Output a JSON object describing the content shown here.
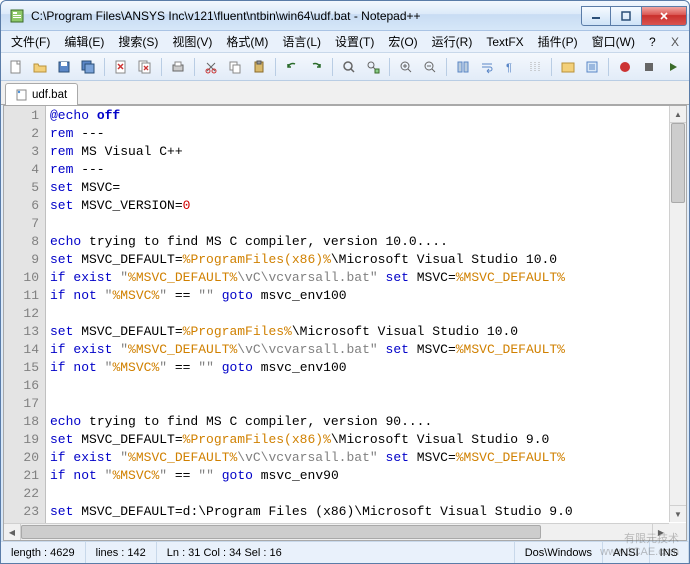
{
  "titlebar": {
    "text": "C:\\Program Files\\ANSYS Inc\\v121\\fluent\\ntbin\\win64\\udf.bat - Notepad++"
  },
  "menus": [
    {
      "label": "文件(F)"
    },
    {
      "label": "编辑(E)"
    },
    {
      "label": "搜索(S)"
    },
    {
      "label": "视图(V)"
    },
    {
      "label": "格式(M)"
    },
    {
      "label": "语言(L)"
    },
    {
      "label": "设置(T)"
    },
    {
      "label": "宏(O)"
    },
    {
      "label": "运行(R)"
    },
    {
      "label": "TextFX"
    },
    {
      "label": "插件(P)"
    },
    {
      "label": "窗口(W)"
    },
    {
      "label": "?"
    }
  ],
  "menu_close": "X",
  "tab": {
    "label": "udf.bat"
  },
  "code_lines": [
    {
      "n": 1,
      "tokens": [
        [
          "cmd",
          "@echo"
        ],
        [
          "",
          ""
        ],
        [
          "kw",
          " off"
        ]
      ]
    },
    {
      "n": 2,
      "tokens": [
        [
          "cmd",
          "rem"
        ],
        [
          "",
          " ---"
        ]
      ]
    },
    {
      "n": 3,
      "tokens": [
        [
          "cmd",
          "rem"
        ],
        [
          "",
          " MS Visual C++"
        ]
      ]
    },
    {
      "n": 4,
      "tokens": [
        [
          "cmd",
          "rem"
        ],
        [
          "",
          " ---"
        ]
      ]
    },
    {
      "n": 5,
      "tokens": [
        [
          "cmd",
          "set"
        ],
        [
          "",
          " MSVC"
        ],
        [
          "op",
          "="
        ]
      ]
    },
    {
      "n": 6,
      "tokens": [
        [
          "cmd",
          "set"
        ],
        [
          "",
          " MSVC_VERSION"
        ],
        [
          "op",
          "="
        ],
        [
          "num",
          "0"
        ]
      ]
    },
    {
      "n": 7,
      "tokens": [
        [
          "",
          ""
        ]
      ]
    },
    {
      "n": 8,
      "tokens": [
        [
          "cmd",
          "echo"
        ],
        [
          "",
          " trying to find MS C compiler, version 10.0...."
        ]
      ]
    },
    {
      "n": 9,
      "tokens": [
        [
          "cmd",
          "set"
        ],
        [
          "",
          " MSVC_DEFAULT"
        ],
        [
          "op",
          "="
        ],
        [
          "var",
          "%ProgramFiles(x86)%"
        ],
        [
          "",
          "\\Microsoft Visual Studio 10.0"
        ]
      ]
    },
    {
      "n": 10,
      "tokens": [
        [
          "cmd",
          "if exist"
        ],
        [
          "",
          " "
        ],
        [
          "str",
          "\""
        ],
        [
          "var",
          "%MSVC_DEFAULT%"
        ],
        [
          "str",
          "\\vC\\vcvarsall.bat\""
        ],
        [
          "",
          " "
        ],
        [
          "cmd",
          "set"
        ],
        [
          "",
          " MSVC"
        ],
        [
          "op",
          "="
        ],
        [
          "var",
          "%MSVC_DEFAULT%"
        ]
      ]
    },
    {
      "n": 11,
      "tokens": [
        [
          "cmd",
          "if not"
        ],
        [
          "",
          " "
        ],
        [
          "str",
          "\""
        ],
        [
          "var",
          "%MSVC%"
        ],
        [
          "str",
          "\""
        ],
        [
          "",
          " "
        ],
        [
          "op",
          "=="
        ],
        [
          "",
          " "
        ],
        [
          "str",
          "\"\""
        ],
        [
          "",
          " "
        ],
        [
          "cmd",
          "goto"
        ],
        [
          "",
          " msvc_env100"
        ]
      ]
    },
    {
      "n": 12,
      "tokens": [
        [
          "",
          ""
        ]
      ]
    },
    {
      "n": 13,
      "tokens": [
        [
          "cmd",
          "set"
        ],
        [
          "",
          " MSVC_DEFAULT"
        ],
        [
          "op",
          "="
        ],
        [
          "var",
          "%ProgramFiles%"
        ],
        [
          "",
          "\\Microsoft Visual Studio 10.0"
        ]
      ]
    },
    {
      "n": 14,
      "tokens": [
        [
          "cmd",
          "if exist"
        ],
        [
          "",
          " "
        ],
        [
          "str",
          "\""
        ],
        [
          "var",
          "%MSVC_DEFAULT%"
        ],
        [
          "str",
          "\\vC\\vcvarsall.bat\""
        ],
        [
          "",
          " "
        ],
        [
          "cmd",
          "set"
        ],
        [
          "",
          " MSVC"
        ],
        [
          "op",
          "="
        ],
        [
          "var",
          "%MSVC_DEFAULT%"
        ]
      ]
    },
    {
      "n": 15,
      "tokens": [
        [
          "cmd",
          "if not"
        ],
        [
          "",
          " "
        ],
        [
          "str",
          "\""
        ],
        [
          "var",
          "%MSVC%"
        ],
        [
          "str",
          "\""
        ],
        [
          "",
          " "
        ],
        [
          "op",
          "=="
        ],
        [
          "",
          " "
        ],
        [
          "str",
          "\"\""
        ],
        [
          "",
          " "
        ],
        [
          "cmd",
          "goto"
        ],
        [
          "",
          " msvc_env100"
        ]
      ]
    },
    {
      "n": 16,
      "tokens": [
        [
          "",
          ""
        ]
      ]
    },
    {
      "n": 17,
      "tokens": [
        [
          "",
          ""
        ]
      ]
    },
    {
      "n": 18,
      "tokens": [
        [
          "cmd",
          "echo"
        ],
        [
          "",
          " trying to find MS C compiler, version 90...."
        ]
      ]
    },
    {
      "n": 19,
      "tokens": [
        [
          "cmd",
          "set"
        ],
        [
          "",
          " MSVC_DEFAULT"
        ],
        [
          "op",
          "="
        ],
        [
          "var",
          "%ProgramFiles(x86)%"
        ],
        [
          "",
          "\\Microsoft Visual Studio 9.0"
        ]
      ]
    },
    {
      "n": 20,
      "tokens": [
        [
          "cmd",
          "if exist"
        ],
        [
          "",
          " "
        ],
        [
          "str",
          "\""
        ],
        [
          "var",
          "%MSVC_DEFAULT%"
        ],
        [
          "str",
          "\\vC\\vcvarsall.bat\""
        ],
        [
          "",
          " "
        ],
        [
          "cmd",
          "set"
        ],
        [
          "",
          " MSVC"
        ],
        [
          "op",
          "="
        ],
        [
          "var",
          "%MSVC_DEFAULT%"
        ]
      ]
    },
    {
      "n": 21,
      "tokens": [
        [
          "cmd",
          "if not"
        ],
        [
          "",
          " "
        ],
        [
          "str",
          "\""
        ],
        [
          "var",
          "%MSVC%"
        ],
        [
          "str",
          "\""
        ],
        [
          "",
          " "
        ],
        [
          "op",
          "=="
        ],
        [
          "",
          " "
        ],
        [
          "str",
          "\"\""
        ],
        [
          "",
          " "
        ],
        [
          "cmd",
          "goto"
        ],
        [
          "",
          " msvc_env90"
        ]
      ]
    },
    {
      "n": 22,
      "tokens": [
        [
          "",
          ""
        ]
      ]
    },
    {
      "n": 23,
      "tokens": [
        [
          "cmd",
          "set"
        ],
        [
          "",
          " MSVC_DEFAULT"
        ],
        [
          "op",
          "="
        ],
        [
          "",
          "d:\\Program Files (x86)\\Microsoft Visual Studio 9.0"
        ]
      ]
    }
  ],
  "status": {
    "length": "length : 4629",
    "lines": "lines : 142",
    "pos": "Ln : 31    Col : 34    Sel : 16",
    "eol": "Dos\\Windows",
    "encoding": "ANSI",
    "ins": "INS"
  },
  "watermark": {
    "l1": "有限元技术",
    "l2": "www.1CAE.com"
  }
}
